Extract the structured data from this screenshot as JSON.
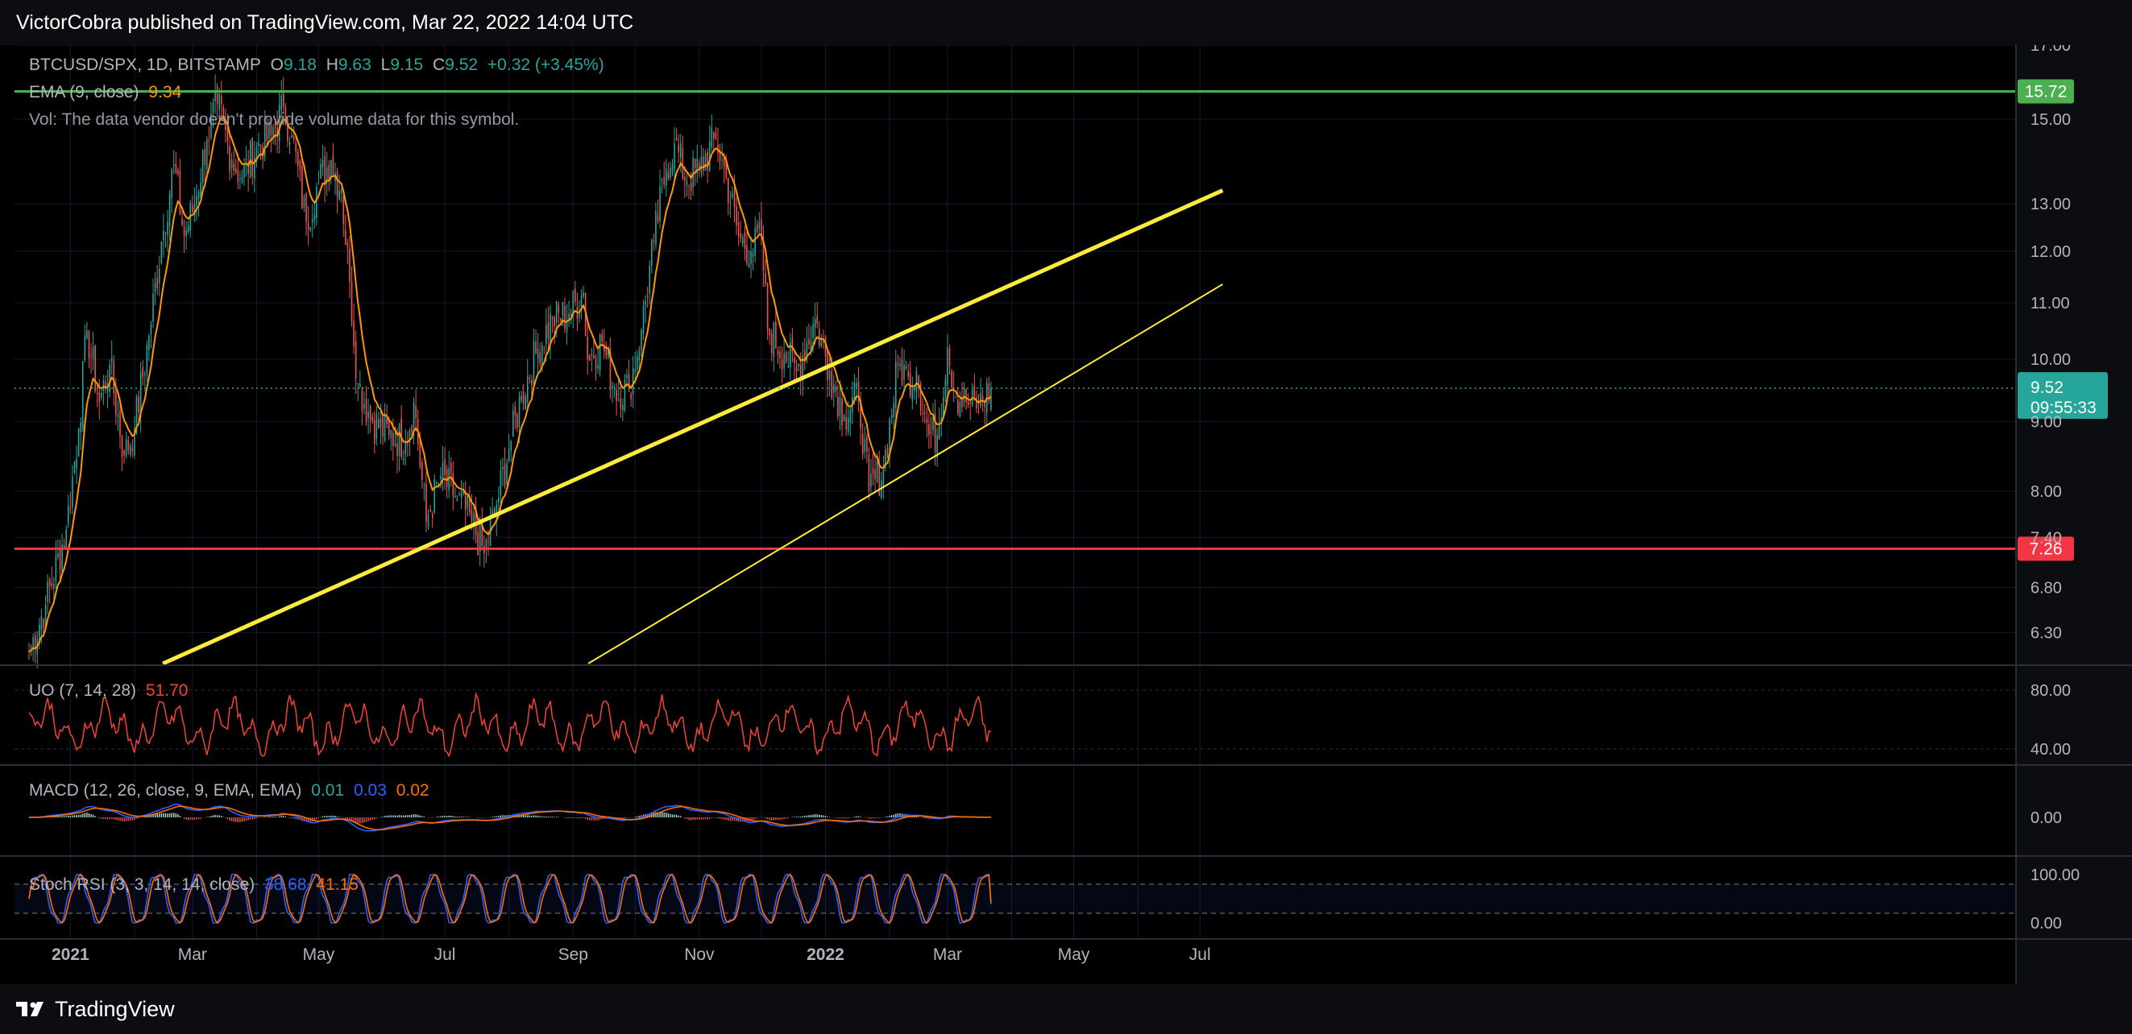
{
  "header": {
    "text": "VictorCobra published on TradingView.com, Mar 22, 2022 14:04 UTC"
  },
  "footer": {
    "brand": "TradingView"
  },
  "legend": {
    "symbol": "BTCUSD/SPX, 1D, BITSTAMP",
    "o_label": "O",
    "o_value": "9.18",
    "h_label": "H",
    "h_value": "9.63",
    "l_label": "L",
    "l_value": "9.15",
    "c_label": "C",
    "c_value": "9.52",
    "change": "+0.32 (+3.45%)",
    "ema_label": "EMA (9, close)",
    "ema_value": "9.34",
    "vol_text": "Vol: The data vendor doesn't provide volume data for this symbol.",
    "uo_label": "UO (7, 14, 28)",
    "uo_value": "51.70",
    "macd_label": "MACD (12, 26, close, 9, EMA, EMA)",
    "macd_v1": "0.01",
    "macd_v2": "0.03",
    "macd_v3": "0.02",
    "stoch_label": "Stoch RSI (3, 3, 14, 14, close)",
    "stoch_k": "38.68",
    "stoch_d": "41.15"
  },
  "colors": {
    "up": "#26a69a",
    "down": "#ef5350",
    "ema": "#ff9800",
    "resistance": "#4caf50",
    "support": "#f23645",
    "trend": "#ffeb3b",
    "uo": "#f44336",
    "macd": "#2962ff",
    "signal": "#ff6d00",
    "stoch_k": "#2962ff",
    "stoch_d": "#ff6d00"
  },
  "chart_data": {
    "type": "candlestick",
    "symbol": "BTCUSD/SPX",
    "interval": "1D",
    "exchange": "BITSTAMP",
    "price_axis_ticks": [
      "17.00",
      "15.00",
      "13.00",
      "12.00",
      "11.00",
      "10.00",
      "9.00",
      "8.00",
      "7.40",
      "6.80",
      "6.30"
    ],
    "time_axis_labels": [
      "2021",
      "Mar",
      "May",
      "Jul",
      "Sep",
      "Nov",
      "2022",
      "Mar",
      "May",
      "Jul"
    ],
    "price_scale": "log",
    "ylim": [
      6.0,
      17.0
    ],
    "close_anchor_points": [
      [
        "2020-12-12",
        6.1
      ],
      [
        "2020-12-20",
        6.6
      ],
      [
        "2020-12-30",
        7.5
      ],
      [
        "2021-01-05",
        8.9
      ],
      [
        "2021-01-09",
        10.5
      ],
      [
        "2021-01-15",
        9.3
      ],
      [
        "2021-01-20",
        9.9
      ],
      [
        "2021-01-27",
        8.5
      ],
      [
        "2021-02-01",
        8.9
      ],
      [
        "2021-02-08",
        10.4
      ],
      [
        "2021-02-14",
        12.2
      ],
      [
        "2021-02-20",
        13.9
      ],
      [
        "2021-02-25",
        12.3
      ],
      [
        "2021-03-02",
        13.0
      ],
      [
        "2021-03-08",
        14.5
      ],
      [
        "2021-03-13",
        15.4
      ],
      [
        "2021-03-20",
        14.0
      ],
      [
        "2021-03-25",
        13.6
      ],
      [
        "2021-04-01",
        14.3
      ],
      [
        "2021-04-08",
        14.6
      ],
      [
        "2021-04-14",
        15.3
      ],
      [
        "2021-04-18",
        14.6
      ],
      [
        "2021-04-25",
        12.6
      ],
      [
        "2021-05-01",
        13.5
      ],
      [
        "2021-05-07",
        14.0
      ],
      [
        "2021-05-12",
        13.3
      ],
      [
        "2021-05-16",
        11.4
      ],
      [
        "2021-05-20",
        9.6
      ],
      [
        "2021-05-27",
        9.0
      ],
      [
        "2021-06-04",
        8.8
      ],
      [
        "2021-06-12",
        8.7
      ],
      [
        "2021-06-16",
        9.3
      ],
      [
        "2021-06-22",
        7.6
      ],
      [
        "2021-06-29",
        8.2
      ],
      [
        "2021-07-07",
        7.9
      ],
      [
        "2021-07-14",
        7.6
      ],
      [
        "2021-07-20",
        7.2
      ],
      [
        "2021-07-25",
        7.7
      ],
      [
        "2021-08-01",
        8.6
      ],
      [
        "2021-08-07",
        9.4
      ],
      [
        "2021-08-14",
        10.1
      ],
      [
        "2021-08-22",
        10.7
      ],
      [
        "2021-08-30",
        10.8
      ],
      [
        "2021-09-06",
        11.2
      ],
      [
        "2021-09-08",
        10.0
      ],
      [
        "2021-09-15",
        10.3
      ],
      [
        "2021-09-21",
        9.5
      ],
      [
        "2021-09-28",
        9.5
      ],
      [
        "2021-10-04",
        10.5
      ],
      [
        "2021-10-10",
        12.2
      ],
      [
        "2021-10-16",
        13.8
      ],
      [
        "2021-10-20",
        14.4
      ],
      [
        "2021-10-26",
        13.5
      ],
      [
        "2021-11-01",
        13.8
      ],
      [
        "2021-11-09",
        14.5
      ],
      [
        "2021-11-14",
        13.6
      ],
      [
        "2021-11-20",
        12.3
      ],
      [
        "2021-11-26",
        12.0
      ],
      [
        "2021-12-01",
        12.3
      ],
      [
        "2021-12-04",
        10.5
      ],
      [
        "2021-12-12",
        10.1
      ],
      [
        "2021-12-18",
        9.8
      ],
      [
        "2021-12-27",
        10.7
      ],
      [
        "2022-01-03",
        9.8
      ],
      [
        "2022-01-10",
        9.1
      ],
      [
        "2022-01-17",
        9.4
      ],
      [
        "2022-01-22",
        8.0
      ],
      [
        "2022-01-29",
        8.3
      ],
      [
        "2022-02-05",
        9.9
      ],
      [
        "2022-02-10",
        9.7
      ],
      [
        "2022-02-14",
        9.8
      ],
      [
        "2022-02-20",
        8.8
      ],
      [
        "2022-02-24",
        8.8
      ],
      [
        "2022-03-01",
        10.2
      ],
      [
        "2022-03-05",
        9.4
      ],
      [
        "2022-03-10",
        9.3
      ],
      [
        "2022-03-15",
        9.2
      ],
      [
        "2022-03-22",
        9.52
      ]
    ],
    "ohlc_last": {
      "open": 9.18,
      "high": 9.63,
      "low": 9.15,
      "close": 9.52,
      "change": 0.32,
      "change_pct": 3.45
    },
    "ema_last": 9.34,
    "horizontal_levels": [
      {
        "name": "resistance",
        "value": 15.72
      },
      {
        "name": "support",
        "value": 7.26
      }
    ],
    "trendlines": [
      {
        "name": "upper",
        "points": [
          [
            "2020-12-15",
            5.43
          ],
          [
            "2022-07-12",
            13.3
          ]
        ]
      },
      {
        "name": "lower",
        "points": [
          [
            "2020-12-15",
            3.42
          ],
          [
            "2022-07-12",
            11.35
          ]
        ]
      }
    ],
    "last_price_tag": {
      "price": "9.52",
      "countdown": "09:55:33"
    },
    "indicators": {
      "uo": {
        "params": [
          7,
          14,
          28
        ],
        "last": 51.7,
        "ticks": [
          "80.00",
          "40.00"
        ]
      },
      "macd": {
        "params": [
          12,
          26,
          9
        ],
        "macd": 0.03,
        "signal": 0.02,
        "histogram": 0.01,
        "ticks": [
          "0.00"
        ]
      },
      "stoch_rsi": {
        "params": [
          3,
          3,
          14,
          14
        ],
        "k": 38.68,
        "d": 41.15,
        "ticks": [
          "100.00",
          "0.00"
        ]
      }
    }
  }
}
